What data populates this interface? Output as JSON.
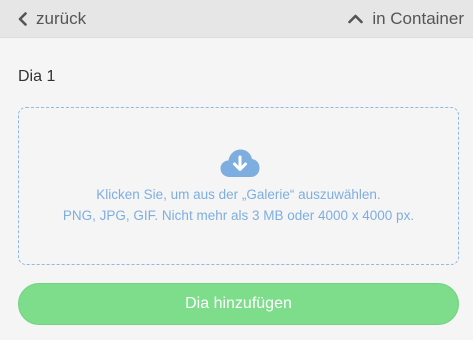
{
  "header": {
    "back_label": "zurück",
    "container_label": "in Container",
    "back_icon": "chevron-left-icon",
    "container_icon": "chevron-up-icon"
  },
  "slide": {
    "title": "Dia 1"
  },
  "dropzone": {
    "icon": "cloud-download-icon",
    "line1": "Klicken Sie, um aus der „Galerie“ auszuwählen.",
    "line2": "PNG, JPG, GIF. Nicht mehr als 3 MB oder 4000 x 4000 px."
  },
  "actions": {
    "add_slide_label": "Dia hinzufügen"
  },
  "colors": {
    "accent_blue": "#7eaee0",
    "button_green": "#7ddd8b",
    "header_bg": "#e6e6e6",
    "page_bg": "#f5f5f5"
  }
}
